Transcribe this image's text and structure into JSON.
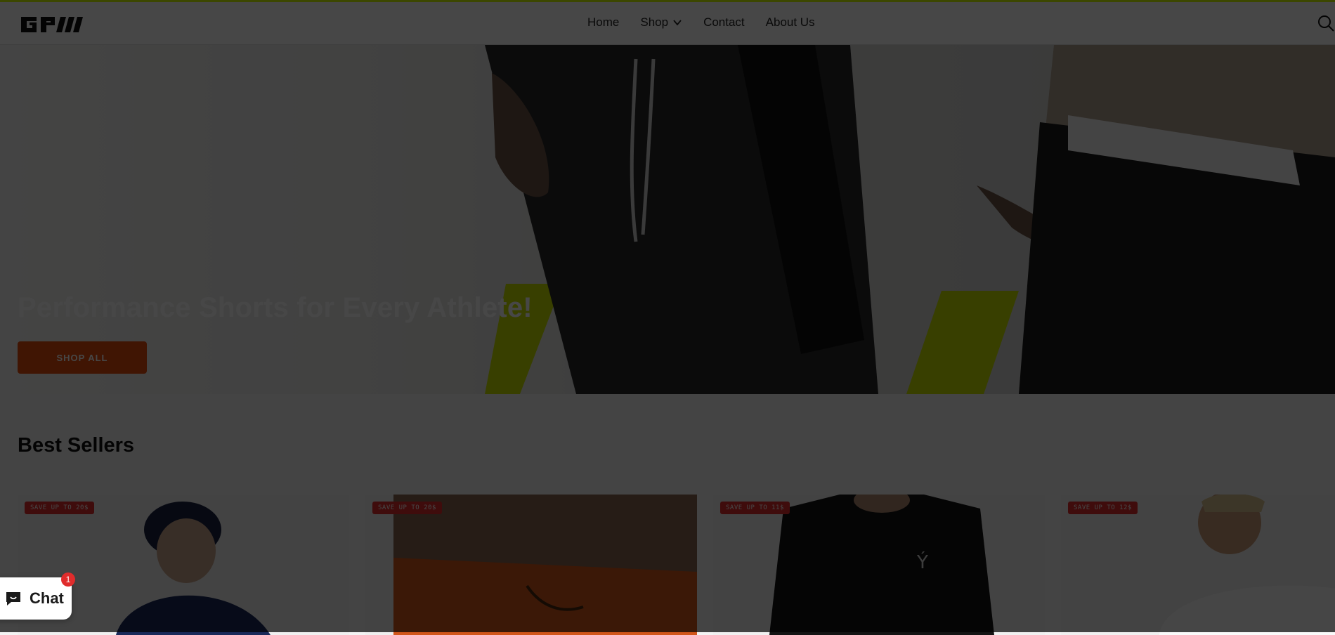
{
  "header": {
    "nav": [
      {
        "label": "Home"
      },
      {
        "label": "Shop"
      },
      {
        "label": "Contact"
      },
      {
        "label": "About Us"
      }
    ]
  },
  "hero": {
    "title": "Performance Shorts for Every Athlete!",
    "button_label": "SHOP ALL"
  },
  "best_sellers": {
    "title": "Best Sellers",
    "cards": [
      {
        "badge": "SAVE UP TO 20$"
      },
      {
        "badge": "SAVE UP TO 20$"
      },
      {
        "badge": "SAVE UP TO 11$"
      },
      {
        "badge": "SAVE UP TO 12$"
      }
    ]
  },
  "chat": {
    "label": "Chat",
    "count": "1"
  },
  "colors": {
    "accent": "#d6ff00",
    "button": "#e74c0c",
    "badge": "#e02c2c",
    "overlay": "rgba(0,0,0,0.72)"
  },
  "icons": [
    "logo",
    "chevron-down-icon",
    "search-icon",
    "chat-icon"
  ]
}
